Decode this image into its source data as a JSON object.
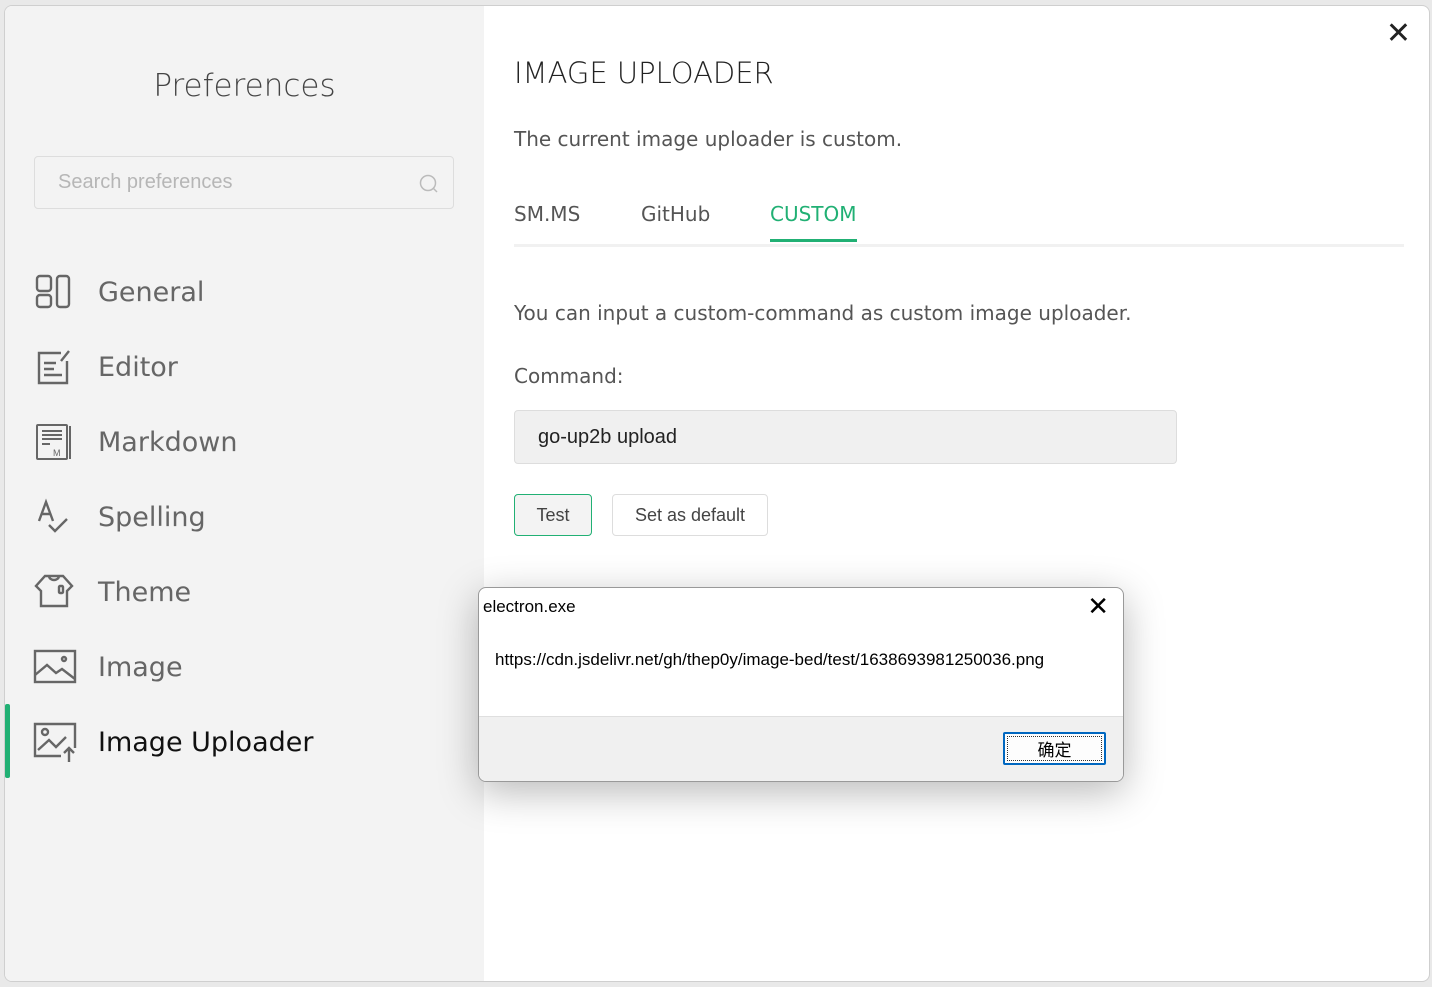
{
  "sidebar": {
    "title": "Preferences",
    "search_placeholder": "Search preferences",
    "items": [
      {
        "label": "General"
      },
      {
        "label": "Editor"
      },
      {
        "label": "Markdown"
      },
      {
        "label": "Spelling"
      },
      {
        "label": "Theme"
      },
      {
        "label": "Image"
      },
      {
        "label": "Image Uploader"
      }
    ],
    "active": "Image Uploader"
  },
  "main": {
    "title": "IMAGE UPLOADER",
    "current": "The current image uploader is custom.",
    "tabs": [
      {
        "label": "SM.MS"
      },
      {
        "label": "GitHub"
      },
      {
        "label": "CUSTOM"
      }
    ],
    "description": "You can input a custom-command as custom image uploader.",
    "command_label": "Command:",
    "command_value": "go-up2b upload",
    "test_label": "Test",
    "default_label": "Set as default"
  },
  "dialog": {
    "title": "electron.exe",
    "message": "https://cdn.jsdelivr.net/gh/thep0y/image-bed/test/1638693981250036.png",
    "ok_label": "确定"
  },
  "colors": {
    "accent": "#21b074"
  }
}
